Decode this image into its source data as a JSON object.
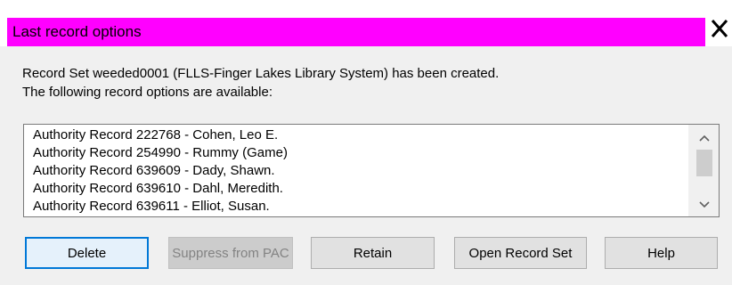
{
  "window": {
    "title": "Last record options",
    "title_bar_color": "#ff00ff",
    "close_icon": "close-icon"
  },
  "message": {
    "line1": "Record Set weeded0001 (FLLS-Finger Lakes Library System) has been created.",
    "line2": "The following record options are available:"
  },
  "records": {
    "items": [
      "Authority Record 222768 - Cohen, Leo E.",
      "Authority Record 254990 - Rummy (Game)",
      "Authority Record 639609 - Dady, Shawn.",
      "Authority Record 639610 - Dahl, Meredith.",
      "Authority Record 639611 - Elliot, Susan."
    ]
  },
  "buttons": {
    "delete": "Delete",
    "suppress": "Suppress from PAC",
    "retain": "Retain",
    "open_record_set": "Open Record Set",
    "help": "Help"
  },
  "colors": {
    "focused_border": "#0078d7",
    "disabled_text": "#838383"
  }
}
